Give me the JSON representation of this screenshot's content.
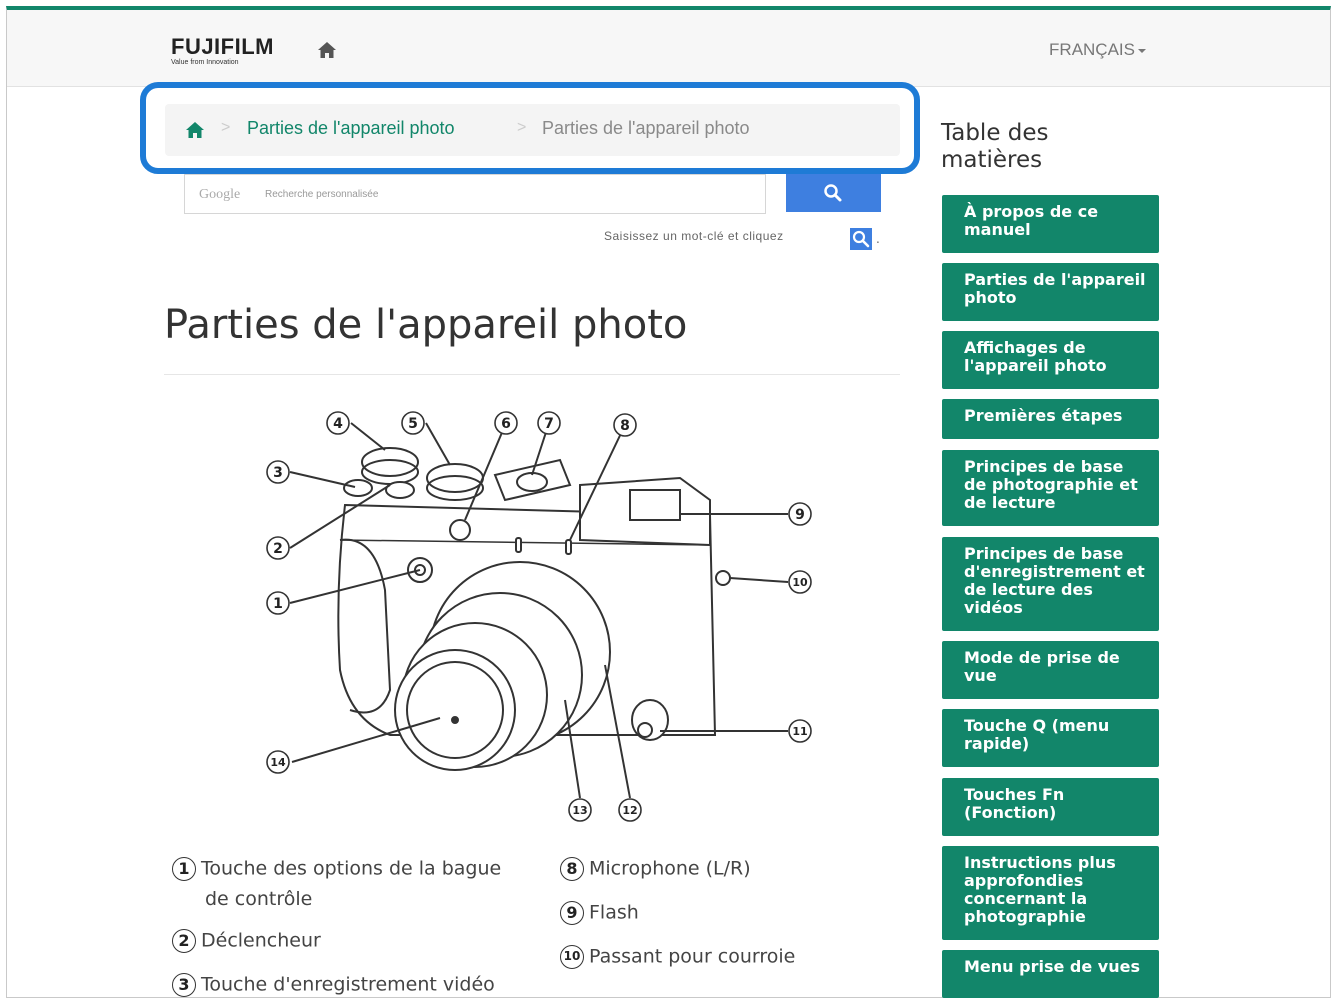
{
  "header": {
    "logo": "FUJIFILM",
    "logo_tagline": "Value from Innovation",
    "language": "FRANÇAIS"
  },
  "breadcrumb": {
    "link": "Parties de l'appareil photo",
    "current": "Parties de l'appareil photo"
  },
  "search": {
    "google_label": "Google",
    "placeholder": "Recherche personnalisée",
    "hint": "Saisissez un mot-clé et cliquez",
    "hint_end": "."
  },
  "page": {
    "title": "Parties de l'appareil photo"
  },
  "diagram_numbers": [
    "1",
    "2",
    "3",
    "4",
    "5",
    "6",
    "7",
    "8",
    "9",
    "10",
    "11",
    "12",
    "13",
    "14"
  ],
  "legend": {
    "left": [
      {
        "num": "1",
        "line1": "Touche des options de la bague",
        "line2": "de contrôle"
      },
      {
        "num": "2",
        "line1": "Déclencheur"
      },
      {
        "num": "3",
        "line1": "Touche d'enregistrement vidéo"
      }
    ],
    "right": [
      {
        "num": "8",
        "line1": "Microphone (L/R)"
      },
      {
        "num": "9",
        "line1": "Flash"
      },
      {
        "num": "10",
        "line1": "Passant pour courroie"
      }
    ]
  },
  "toc": {
    "title_line1": "Table des",
    "title_line2": "matières",
    "items": [
      "À propos de ce manuel",
      "Parties de l'appareil photo",
      "Affichages de l'appareil photo",
      "Premières étapes",
      "Principes de base de photographie et de lecture",
      "Principes de base d'enregistrement et de lecture des vidéos",
      "Mode de prise de vue",
      "Touche Q (menu rapide)",
      "Touches Fn (Fonction)",
      "Instructions plus approfondies concernant la photographie",
      "Menu prise de vues"
    ]
  },
  "colors": {
    "brand_green": "#12866a",
    "highlight_blue": "#1e7bd6",
    "search_blue": "#3e7fe0"
  }
}
